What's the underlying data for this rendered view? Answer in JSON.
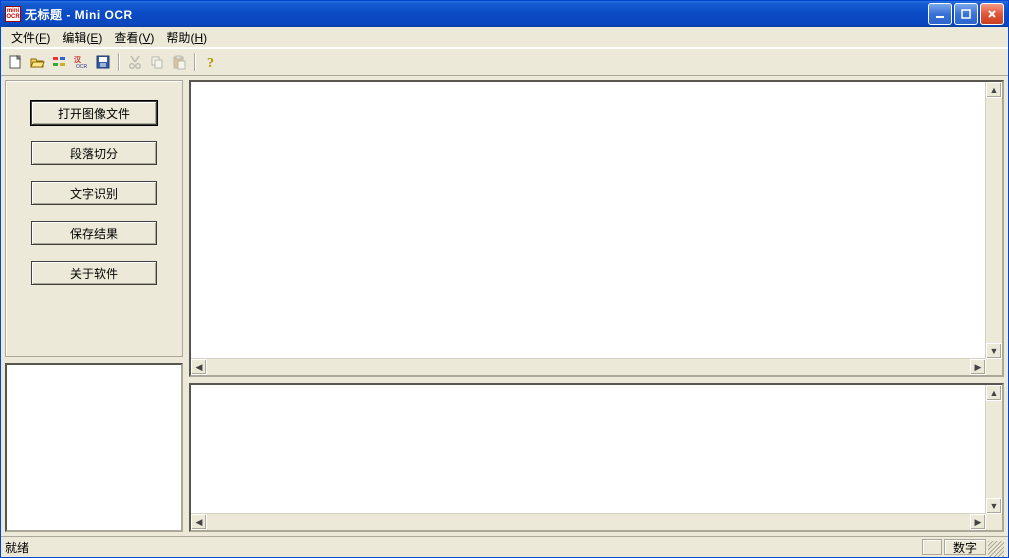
{
  "title": "无标题 - Mini OCR",
  "app_icon": {
    "line1": "mini",
    "line2": "OCR"
  },
  "menu": {
    "file": {
      "label": "文件",
      "accel": "F"
    },
    "edit": {
      "label": "编辑",
      "accel": "E"
    },
    "view": {
      "label": "查看",
      "accel": "V"
    },
    "help": {
      "label": "帮助",
      "accel": "H"
    }
  },
  "toolbar": {
    "new": "new-icon",
    "open": "open-icon",
    "segment": "segment-icon",
    "ocr": "ocr-icon",
    "save": "save-icon",
    "cut": "cut-icon",
    "copy": "copy-icon",
    "paste": "paste-icon",
    "help": "help-icon"
  },
  "buttons": {
    "open_image": "打开图像文件",
    "segment": "段落切分",
    "recognize": "文字识别",
    "save_result": "保存结果",
    "about": "关于软件"
  },
  "status": {
    "ready": "就绪",
    "num": "数字"
  }
}
